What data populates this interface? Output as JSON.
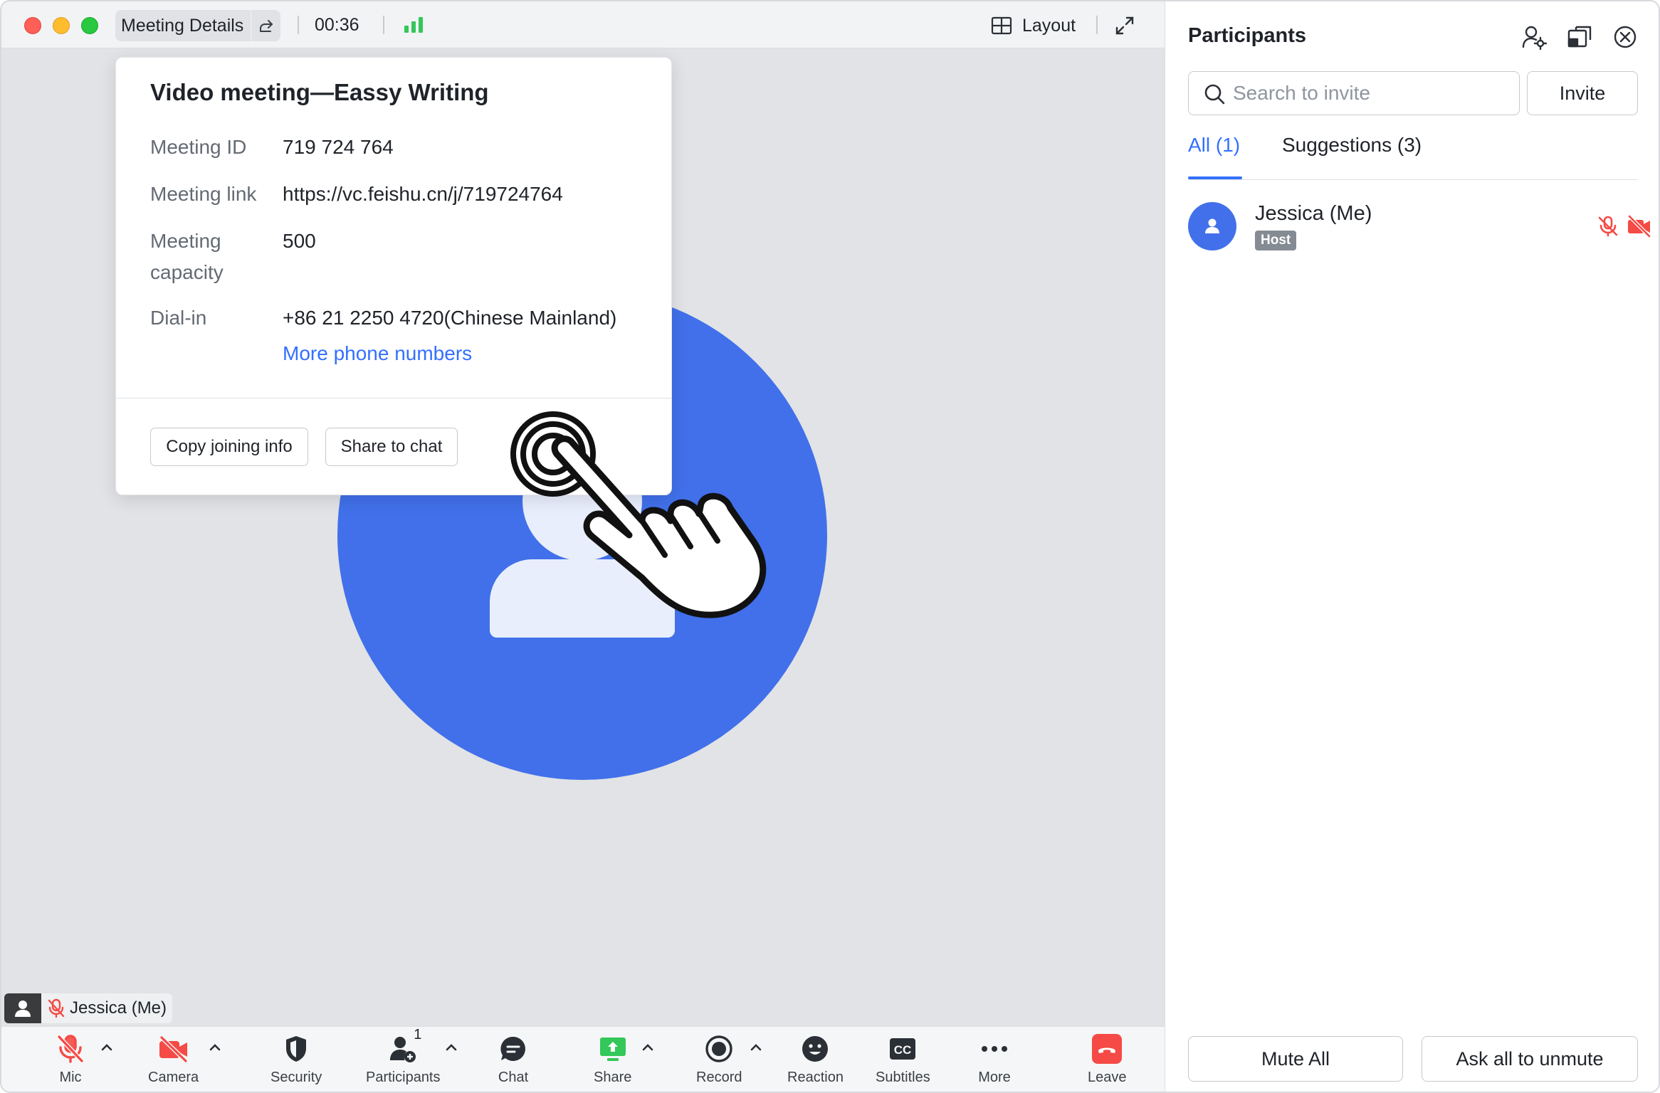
{
  "titlebar": {
    "meeting_details_label": "Meeting Details",
    "timer": "00:36",
    "layout_label": "Layout"
  },
  "popover": {
    "title": "Video meeting—Eassy Writing",
    "rows": [
      {
        "label": "Meeting ID",
        "value": "719 724 764"
      },
      {
        "label": "Meeting link",
        "value": "https://vc.feishu.cn/j/719724764"
      },
      {
        "label": "Meeting capacity",
        "value": "500"
      },
      {
        "label": "Dial-in",
        "value": "+86 21 2250 4720(Chinese Mainland)"
      }
    ],
    "more_numbers_link": "More phone numbers",
    "copy_button": "Copy joining info",
    "share_button": "Share to chat"
  },
  "name_tag": {
    "name": "Jessica (Me)"
  },
  "toolbar": {
    "items": [
      {
        "label": "Mic",
        "icon": "mic-muted-icon"
      },
      {
        "label": "Camera",
        "icon": "camera-off-icon"
      },
      {
        "label": "Security",
        "icon": "shield-icon"
      },
      {
        "label": "Participants",
        "icon": "participants-icon",
        "count": "1"
      },
      {
        "label": "Chat",
        "icon": "chat-icon"
      },
      {
        "label": "Share",
        "icon": "share-screen-icon"
      },
      {
        "label": "Record",
        "icon": "record-icon"
      },
      {
        "label": "Reaction",
        "icon": "smiley-icon"
      },
      {
        "label": "Subtitles",
        "icon": "cc-icon"
      },
      {
        "label": "More",
        "icon": "more-dots-icon"
      },
      {
        "label": "Leave",
        "icon": "hangup-icon"
      }
    ]
  },
  "panel": {
    "title": "Participants",
    "search_placeholder": "Search to invite",
    "invite_button": "Invite",
    "tabs": [
      {
        "label": "All (1)",
        "active": true
      },
      {
        "label": "Suggestions (3)",
        "active": false
      }
    ],
    "participants": [
      {
        "name": "Jessica (Me)",
        "role": "Host",
        "mic": "muted",
        "camera": "off"
      }
    ],
    "mute_all_button": "Mute All",
    "ask_unmute_button": "Ask all to unmute"
  },
  "colors": {
    "accent": "#3370ff",
    "avatar": "#4170ea",
    "muted_red": "#f54a45",
    "signal_green": "#34c759",
    "share_green": "#34c759",
    "leave_red": "#f54a45"
  }
}
